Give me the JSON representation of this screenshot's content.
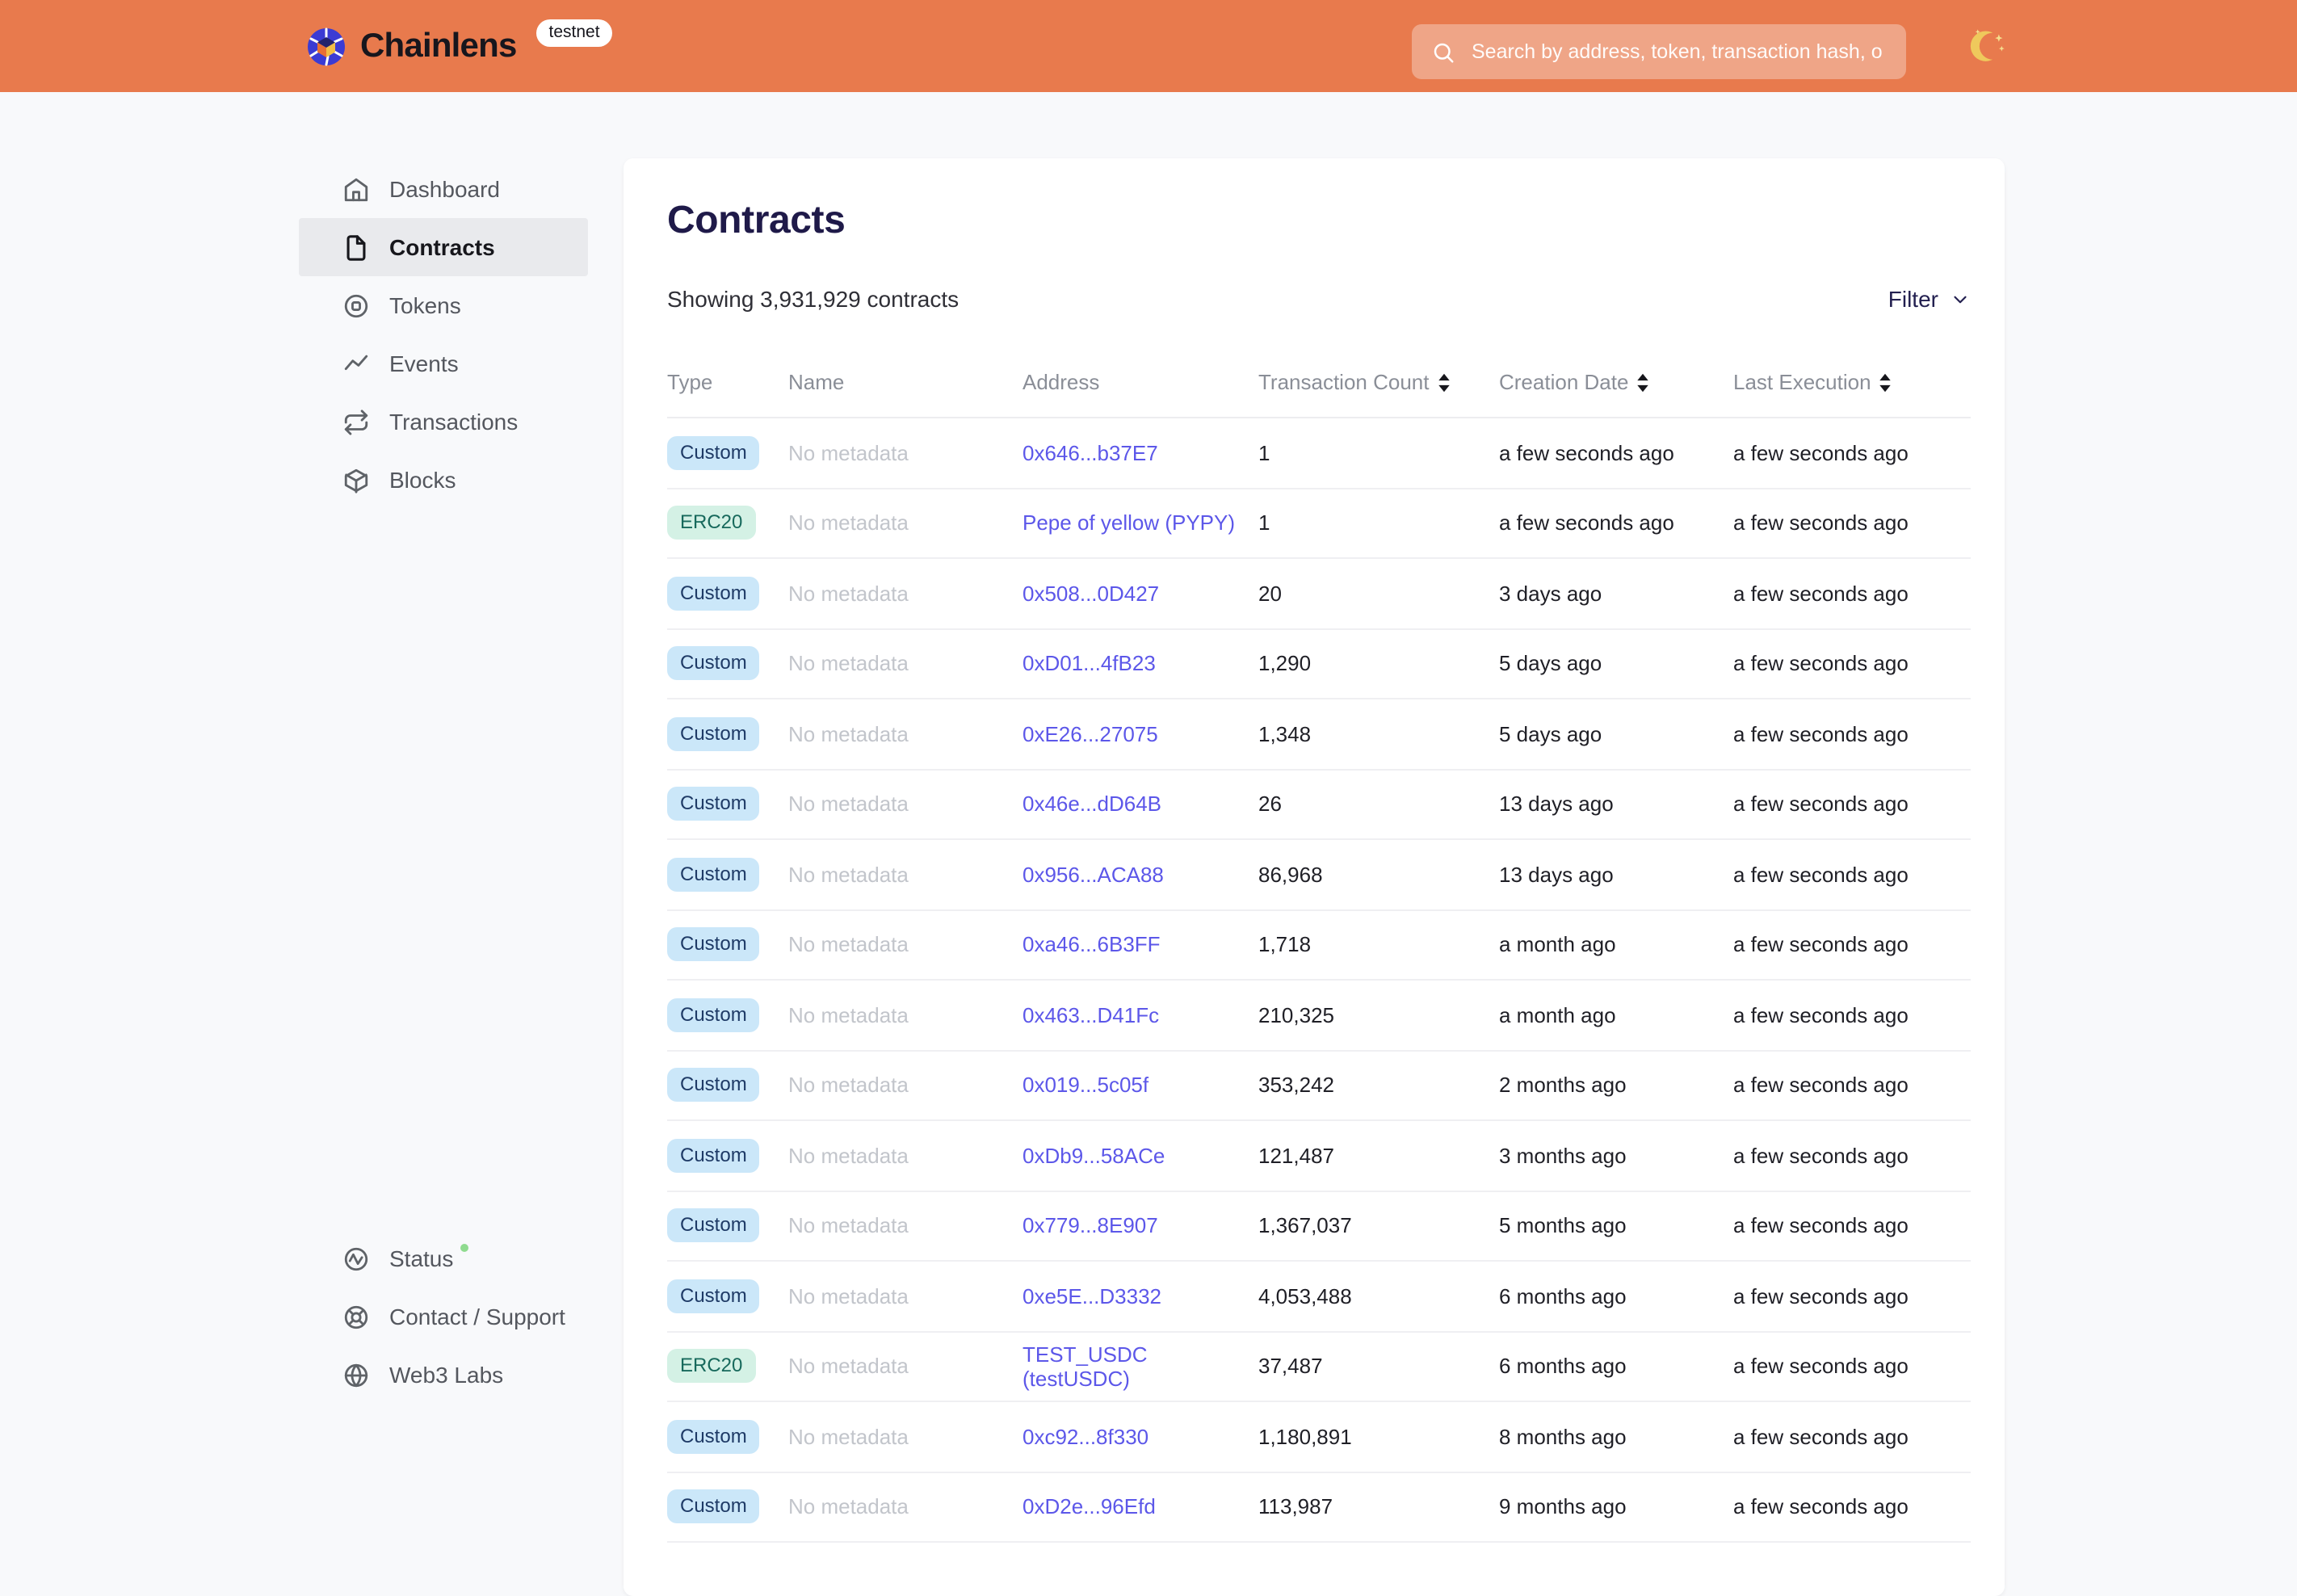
{
  "header": {
    "brand": "Chainlens",
    "env_badge": "testnet",
    "search_placeholder": "Search by address, token, transaction hash, or block number",
    "theme_toggle_icon": "moon-icon"
  },
  "sidebar": {
    "items": [
      {
        "label": "Dashboard",
        "icon": "home-icon",
        "active": false
      },
      {
        "label": "Contracts",
        "icon": "file-icon",
        "active": true
      },
      {
        "label": "Tokens",
        "icon": "token-icon",
        "active": false
      },
      {
        "label": "Events",
        "icon": "activity-icon",
        "active": false
      },
      {
        "label": "Transactions",
        "icon": "repeat-icon",
        "active": false
      },
      {
        "label": "Blocks",
        "icon": "cube-icon",
        "active": false
      }
    ],
    "footer_items": [
      {
        "label": "Status",
        "icon": "pulse-icon",
        "status_dot": true
      },
      {
        "label": "Contact / Support",
        "icon": "lifebuoy-icon"
      },
      {
        "label": "Web3 Labs",
        "icon": "globe-icon"
      }
    ]
  },
  "main": {
    "title": "Contracts",
    "summary": "Showing 3,931,929 contracts",
    "filter_label": "Filter",
    "table": {
      "columns": [
        {
          "label": "Type",
          "sortable": false
        },
        {
          "label": "Name",
          "sortable": false
        },
        {
          "label": "Address",
          "sortable": false
        },
        {
          "label": "Transaction Count",
          "sortable": true
        },
        {
          "label": "Creation Date",
          "sortable": true
        },
        {
          "label": "Last Execution",
          "sortable": true
        }
      ],
      "rows": [
        {
          "type": "Custom",
          "name": "No metadata",
          "address": "0x646...b37E7",
          "tx_count": "1",
          "creation": "a few seconds ago",
          "last_exec": "a few seconds ago"
        },
        {
          "type": "ERC20",
          "name": "No metadata",
          "address": "Pepe of yellow (PYPY)",
          "tx_count": "1",
          "creation": "a few seconds ago",
          "last_exec": "a few seconds ago"
        },
        {
          "type": "Custom",
          "name": "No metadata",
          "address": "0x508...0D427",
          "tx_count": "20",
          "creation": "3 days ago",
          "last_exec": "a few seconds ago"
        },
        {
          "type": "Custom",
          "name": "No metadata",
          "address": "0xD01...4fB23",
          "tx_count": "1,290",
          "creation": "5 days ago",
          "last_exec": "a few seconds ago"
        },
        {
          "type": "Custom",
          "name": "No metadata",
          "address": "0xE26...27075",
          "tx_count": "1,348",
          "creation": "5 days ago",
          "last_exec": "a few seconds ago"
        },
        {
          "type": "Custom",
          "name": "No metadata",
          "address": "0x46e...dD64B",
          "tx_count": "26",
          "creation": "13 days ago",
          "last_exec": "a few seconds ago"
        },
        {
          "type": "Custom",
          "name": "No metadata",
          "address": "0x956...ACA88",
          "tx_count": "86,968",
          "creation": "13 days ago",
          "last_exec": "a few seconds ago"
        },
        {
          "type": "Custom",
          "name": "No metadata",
          "address": "0xa46...6B3FF",
          "tx_count": "1,718",
          "creation": "a month ago",
          "last_exec": "a few seconds ago"
        },
        {
          "type": "Custom",
          "name": "No metadata",
          "address": "0x463...D41Fc",
          "tx_count": "210,325",
          "creation": "a month ago",
          "last_exec": "a few seconds ago"
        },
        {
          "type": "Custom",
          "name": "No metadata",
          "address": "0x019...5c05f",
          "tx_count": "353,242",
          "creation": "2 months ago",
          "last_exec": "a few seconds ago"
        },
        {
          "type": "Custom",
          "name": "No metadata",
          "address": "0xDb9...58ACe",
          "tx_count": "121,487",
          "creation": "3 months ago",
          "last_exec": "a few seconds ago"
        },
        {
          "type": "Custom",
          "name": "No metadata",
          "address": "0x779...8E907",
          "tx_count": "1,367,037",
          "creation": "5 months ago",
          "last_exec": "a few seconds ago"
        },
        {
          "type": "Custom",
          "name": "No metadata",
          "address": "0xe5E...D3332",
          "tx_count": "4,053,488",
          "creation": "6 months ago",
          "last_exec": "a few seconds ago"
        },
        {
          "type": "ERC20",
          "name": "No metadata",
          "address": "TEST_USDC (testUSDC)",
          "tx_count": "37,487",
          "creation": "6 months ago",
          "last_exec": "a few seconds ago"
        },
        {
          "type": "Custom",
          "name": "No metadata",
          "address": "0xc92...8f330",
          "tx_count": "1,180,891",
          "creation": "8 months ago",
          "last_exec": "a few seconds ago"
        },
        {
          "type": "Custom",
          "name": "No metadata",
          "address": "0xD2e...96Efd",
          "tx_count": "113,987",
          "creation": "9 months ago",
          "last_exec": "a few seconds ago"
        }
      ]
    }
  },
  "colors": {
    "header_orange": "#E87A4D",
    "page_background": "#F8F9FB",
    "title_navy": "#1F1A49",
    "link_purple": "#5C57E9",
    "badge_custom_bg": "#CBE7F9",
    "badge_custom_text": "#1E3A66",
    "badge_erc20_bg": "#D4F1E5",
    "badge_erc20_text": "#17695C",
    "status_green": "#8FDB8F",
    "active_item_bg": "#E9EAED"
  }
}
